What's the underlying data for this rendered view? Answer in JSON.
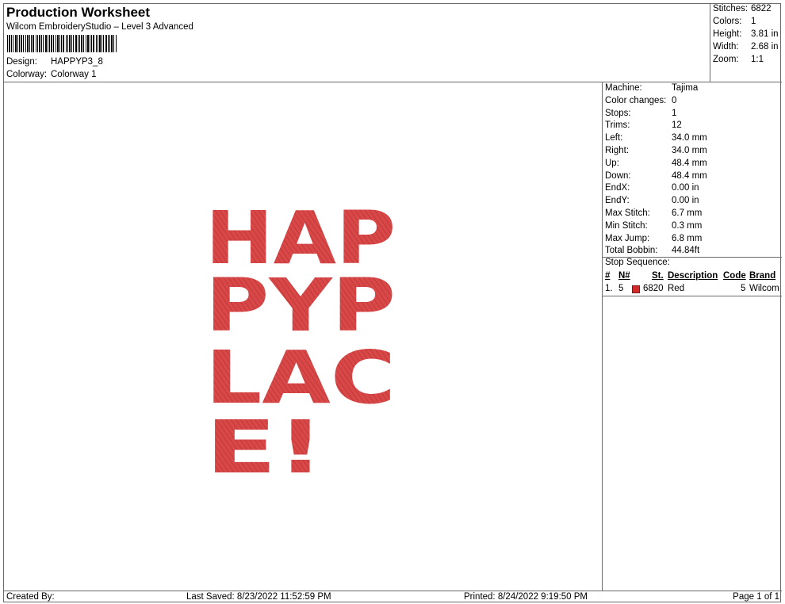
{
  "header": {
    "title": "Production Worksheet",
    "subtitle": "Wilcom EmbroideryStudio – Level 3 Advanced",
    "design_label": "Design:",
    "design_value": "HAPPYP3_8",
    "colorway_label": "Colorway:",
    "colorway_value": "Colorway 1"
  },
  "summary": [
    {
      "label": "Stitches:",
      "value": "6822"
    },
    {
      "label": "Colors:",
      "value": "1"
    },
    {
      "label": "Height:",
      "value": "3.81 in"
    },
    {
      "label": "Width:",
      "value": "2.68 in"
    },
    {
      "label": "Zoom:",
      "value": "1:1"
    }
  ],
  "properties": [
    {
      "label": "Machine:",
      "value": "Tajima"
    },
    {
      "label": "Color changes:",
      "value": "0"
    },
    {
      "label": "Stops:",
      "value": "1"
    },
    {
      "label": "Trims:",
      "value": "12"
    },
    {
      "label": "Left:",
      "value": "34.0 mm"
    },
    {
      "label": "Right:",
      "value": "34.0 mm"
    },
    {
      "label": "Up:",
      "value": "48.4 mm"
    },
    {
      "label": "Down:",
      "value": "48.4 mm"
    },
    {
      "label": "EndX:",
      "value": "0.00 in"
    },
    {
      "label": "EndY:",
      "value": "0.00 in"
    },
    {
      "label": "Max Stitch:",
      "value": "6.7 mm"
    },
    {
      "label": "Min Stitch:",
      "value": "0.3 mm"
    },
    {
      "label": "Max Jump:",
      "value": "6.8 mm"
    },
    {
      "label": "Total Bobbin:",
      "value": "44.84ft"
    }
  ],
  "stop_sequence": {
    "label": "Stop Sequence:",
    "headers": {
      "num": "#",
      "n": "N#",
      "st": "St.",
      "description": "Description",
      "code": "Code",
      "brand": "Brand"
    },
    "rows": [
      {
        "num": "1.",
        "n": "5",
        "color": "#d42a2a",
        "st": "6820",
        "description": "Red",
        "code": "5",
        "brand": "Wilcom"
      }
    ]
  },
  "design": {
    "lines": [
      "HAP",
      "PYP",
      "LAC",
      "E!"
    ],
    "thread_color": "#d94848"
  },
  "footer": {
    "created_by": "Created By:",
    "last_saved": "Last Saved: 8/23/2022 11:52:59 PM",
    "printed": "Printed: 8/24/2022 9:19:50 PM",
    "page": "Page 1 of 1"
  }
}
